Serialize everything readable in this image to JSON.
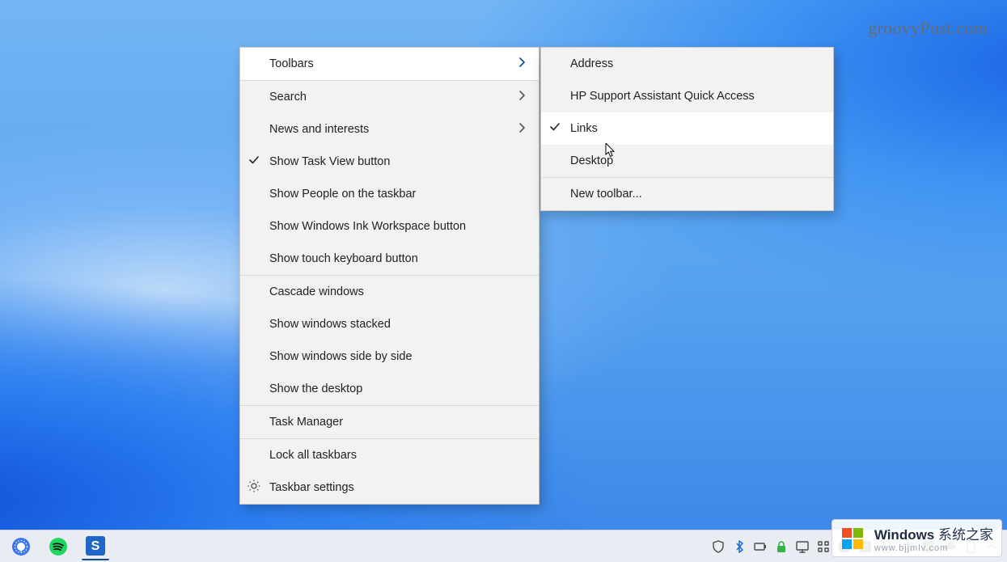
{
  "watermarks": {
    "top_right": "groovyPost.com",
    "bottom_brand": "Windows",
    "bottom_tag": "系统之家",
    "bottom_url": "www.bjjmlv.com"
  },
  "context_menu": {
    "items": [
      {
        "label": "Toolbars",
        "submenu": true,
        "highlight": true
      },
      {
        "sep": true
      },
      {
        "label": "Search",
        "submenu": true
      },
      {
        "label": "News and interests",
        "submenu": true
      },
      {
        "label": "Show Task View button",
        "checked": true
      },
      {
        "label": "Show People on the taskbar"
      },
      {
        "label": "Show Windows Ink Workspace button"
      },
      {
        "label": "Show touch keyboard button"
      },
      {
        "sep": true
      },
      {
        "label": "Cascade windows"
      },
      {
        "label": "Show windows stacked"
      },
      {
        "label": "Show windows side by side"
      },
      {
        "label": "Show the desktop"
      },
      {
        "sep": true
      },
      {
        "label": "Task Manager"
      },
      {
        "sep": true
      },
      {
        "label": "Lock all taskbars"
      },
      {
        "label": "Taskbar settings",
        "icon": "gear"
      }
    ]
  },
  "toolbars_submenu": {
    "items": [
      {
        "label": "Address"
      },
      {
        "label": "HP Support Assistant Quick Access"
      },
      {
        "label": "Links",
        "checked": true,
        "highlight": true
      },
      {
        "label": "Desktop"
      },
      {
        "sep": true
      },
      {
        "label": "New toolbar..."
      }
    ]
  },
  "taskbar": {
    "pinned": [
      {
        "name": "signal-app",
        "color": "#3a76f0"
      },
      {
        "name": "spotify-app",
        "color": "#1ed760"
      },
      {
        "name": "snagit-app",
        "color": "#1e66c7",
        "active": true
      }
    ],
    "tray_icons": [
      "shield-icon",
      "bluetooth-icon",
      "battery-icon",
      "lock-icon",
      "monitor-icon",
      "grid-icon",
      "cloud-up-icon",
      "f-square-icon",
      "phone-icon",
      "speaker-icon",
      "square-icon",
      "cloud-icon",
      "page-icon",
      "chevron-up-icon"
    ]
  }
}
